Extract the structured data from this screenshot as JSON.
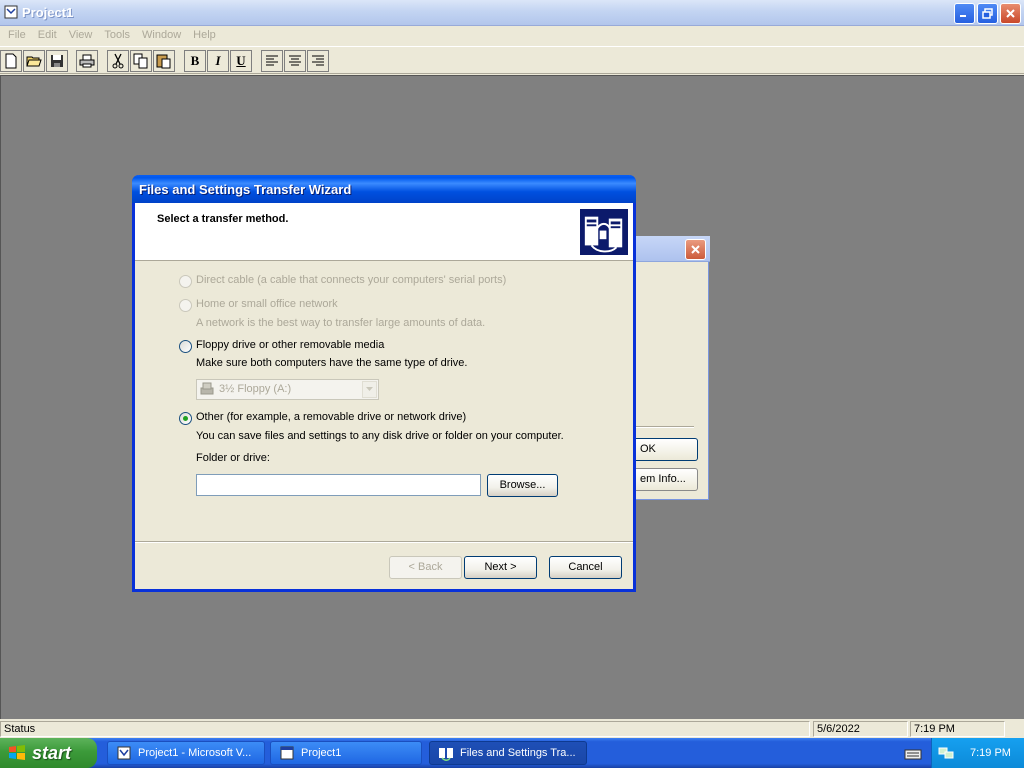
{
  "app": {
    "title": "Project1",
    "menus": [
      "File",
      "Edit",
      "View",
      "Tools",
      "Window",
      "Help"
    ],
    "toolbar": {
      "new_icon": "new-document-icon",
      "open_icon": "open-folder-icon",
      "save_icon": "save-icon",
      "print_icon": "print-icon",
      "cut_icon": "cut-icon",
      "copy_icon": "copy-icon",
      "paste_icon": "paste-icon",
      "bold_label": "B",
      "italic_label": "I",
      "underline_label": "U",
      "align_left_icon": "align-left-icon",
      "align_center_icon": "align-center-icon",
      "align_right_icon": "align-right-icon"
    }
  },
  "statusbar": {
    "status": "Status",
    "date": "5/6/2022",
    "time": "7:19 PM"
  },
  "background_dialog": {
    "ok_label": "OK",
    "info_label": "em Info..."
  },
  "wizard": {
    "title": "Files and Settings Transfer Wizard",
    "header": "Select a transfer method.",
    "options": {
      "direct_cable": "Direct cable (a cable that connects your computers' serial ports)",
      "home_network": "Home or small office network",
      "home_network_desc": "A network is the best way to transfer large amounts of data.",
      "floppy": "Floppy drive or other removable media",
      "floppy_desc": "Make sure both computers have the same type of drive.",
      "floppy_drive_value": "3½ Floppy (A:)",
      "other": "Other (for example, a removable drive or network drive)",
      "other_desc": "You can save files and settings to any disk drive or folder on your computer.",
      "folder_label": "Folder or drive:",
      "folder_value": ""
    },
    "selected_option": "other",
    "buttons": {
      "browse": "Browse...",
      "back": "< Back",
      "next": "Next >",
      "cancel": "Cancel"
    }
  },
  "taskbar": {
    "start_label": "start",
    "tasks": [
      {
        "label": "Project1 - Microsoft V..."
      },
      {
        "label": "Project1"
      },
      {
        "label": "Files and Settings Tra..."
      }
    ],
    "clock": "7:19 PM"
  }
}
